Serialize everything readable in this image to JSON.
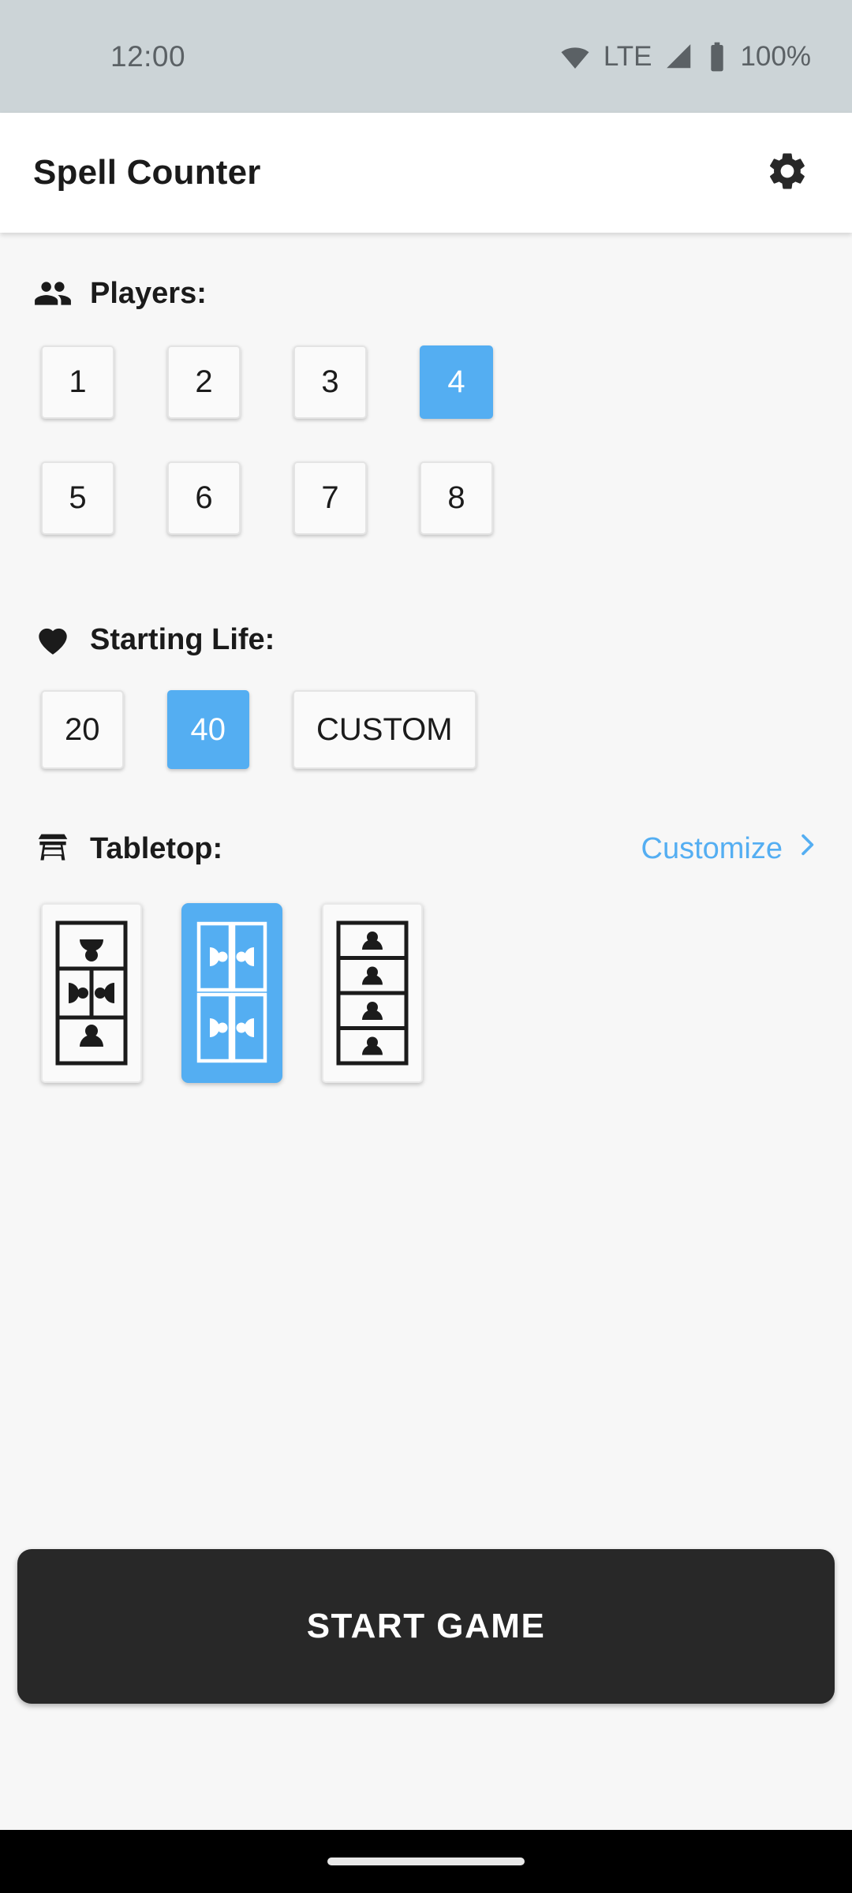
{
  "status_bar": {
    "time": "12:00",
    "network_label": "LTE",
    "battery_percent": "100%",
    "icons": [
      "wifi-icon",
      "signal-icon",
      "battery-icon"
    ],
    "background_color": "#ccd4d7",
    "foreground_color": "#5b6165"
  },
  "app_bar": {
    "title": "Spell Counter",
    "settings_icon": "gear-icon"
  },
  "theme": {
    "accent_color": "#54aef2",
    "page_background": "#f7f7f7",
    "surface": "#fafafa",
    "text_primary": "#1b1b1b",
    "dark_button": "#282828"
  },
  "players_section": {
    "icon": "people-icon",
    "label": "Players:",
    "options": [
      "1",
      "2",
      "3",
      "4",
      "5",
      "6",
      "7",
      "8"
    ],
    "selected": "4"
  },
  "life_section": {
    "icon": "heart-icon",
    "label": "Starting Life:",
    "options": [
      "20",
      "40",
      "CUSTOM"
    ],
    "selected": "40"
  },
  "tabletop_section": {
    "icon": "table-icon",
    "label": "Tabletop:",
    "customize_label": "Customize",
    "customize_chevron": "chevron-right-icon",
    "layouts": [
      {
        "name": "layout-top-two-side-bottom",
        "selected": false,
        "seats": 4,
        "description": "one inverted seat on top, two side-facing seats in middle, one upright seat on bottom"
      },
      {
        "name": "layout-2x2-side-facing",
        "selected": true,
        "seats": 4,
        "description": "two-by-two grid of side-facing seats"
      },
      {
        "name": "layout-four-rows-upright",
        "selected": false,
        "seats": 4,
        "description": "four stacked horizontal rows of upright seats"
      }
    ]
  },
  "start_button": {
    "label": "START GAME"
  },
  "nav_bar": {
    "home_indicator": "home-indicator"
  }
}
